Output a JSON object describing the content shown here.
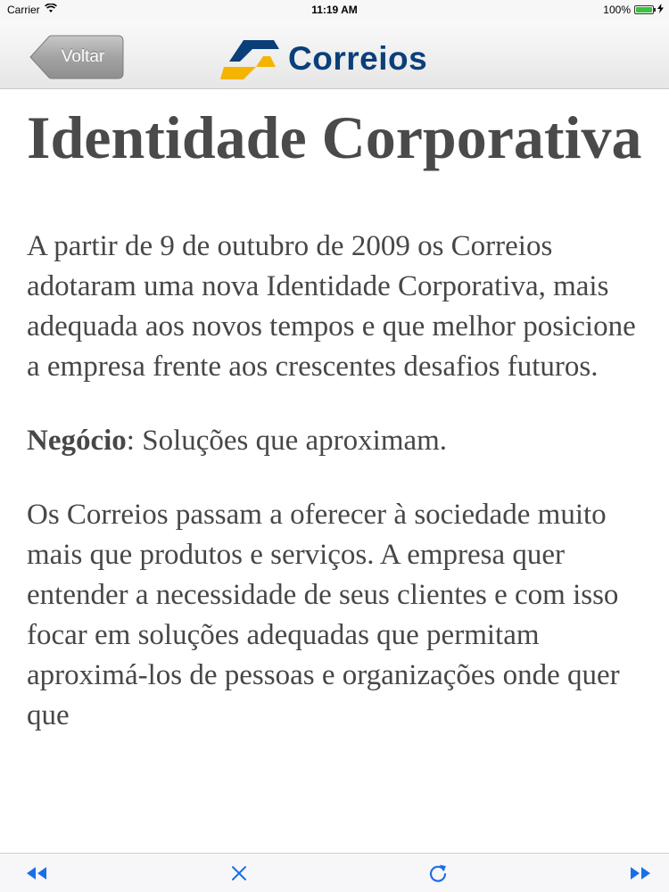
{
  "status_bar": {
    "carrier": "Carrier",
    "time": "11:19 AM",
    "battery": "100%",
    "battery_level": 1.0
  },
  "nav": {
    "back_label": "Voltar",
    "logo_text": "Correios"
  },
  "content": {
    "title": "Identidade Corporativa",
    "paragraph1": "A partir de 9 de outubro de 2009 os Correios adotaram uma nova Identidade Corporativa, mais adequada aos novos tempos e que melhor posicione a empresa frente aos crescentes desafios futuros.",
    "negocio_label": "Negócio",
    "negocio_text": ": Soluções que aproximam.",
    "paragraph3": "Os Correios passam a oferecer à sociedade muito mais que produtos e serviços. A empresa quer entender a necessidade de seus clientes e com isso focar em soluções adequadas que permitam aproximá-los de pessoas e organizações onde quer que"
  },
  "toolbar": {
    "icons": [
      "rewind-icon",
      "close-icon",
      "refresh-icon",
      "fast-forward-icon"
    ],
    "tint": "#1a6fe8"
  },
  "colors": {
    "logo_blue": "#0a3f7a",
    "logo_yellow": "#f5b400",
    "text_gray": "#474747"
  }
}
